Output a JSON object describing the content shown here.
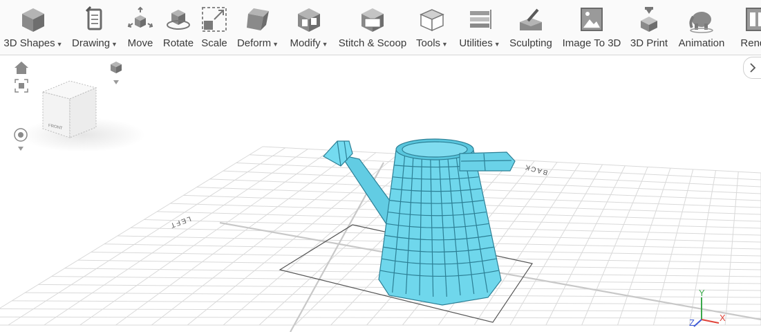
{
  "toolbar": {
    "items": [
      {
        "label": "3D Shapes",
        "dropdown": true,
        "icon": "cube-icon"
      },
      {
        "label": "Drawing",
        "dropdown": true,
        "icon": "drawing-tablet-icon"
      },
      {
        "label": "Move",
        "dropdown": false,
        "icon": "move-arrows-icon"
      },
      {
        "label": "Rotate",
        "dropdown": false,
        "icon": "rotate-cube-icon"
      },
      {
        "label": "Scale",
        "dropdown": false,
        "icon": "scale-box-icon"
      },
      {
        "label": "Deform",
        "dropdown": true,
        "icon": "deform-cube-icon"
      },
      {
        "label": "Modify",
        "dropdown": true,
        "icon": "modify-cube-icon"
      },
      {
        "label": "Stitch & Scoop",
        "dropdown": false,
        "icon": "stitch-scoop-icon"
      },
      {
        "label": "Tools",
        "dropdown": true,
        "icon": "tools-box-icon"
      },
      {
        "label": "Utilities",
        "dropdown": true,
        "icon": "utilities-layers-icon"
      },
      {
        "label": "Sculpting",
        "dropdown": false,
        "icon": "sculpting-brush-icon"
      },
      {
        "label": "Image To 3D",
        "dropdown": false,
        "icon": "image-picture-icon"
      },
      {
        "label": "3D Print",
        "dropdown": false,
        "icon": "printer-3d-icon"
      },
      {
        "label": "Animation",
        "dropdown": false,
        "icon": "elephant-animation-icon"
      },
      {
        "label": "Render",
        "dropdown": false,
        "icon": "render-frame-icon"
      }
    ]
  },
  "viewport": {
    "view_cube_front": "FRONT",
    "grid_label_back": "BACK",
    "grid_label_left": "LEFT",
    "axis_x": "X",
    "axis_y": "Y",
    "axis_z": "Z",
    "model_color": "#6fd7ec"
  },
  "colors": {
    "axis_x": "#e0443a",
    "axis_y": "#3aa84a",
    "axis_z": "#3f5bd6"
  }
}
